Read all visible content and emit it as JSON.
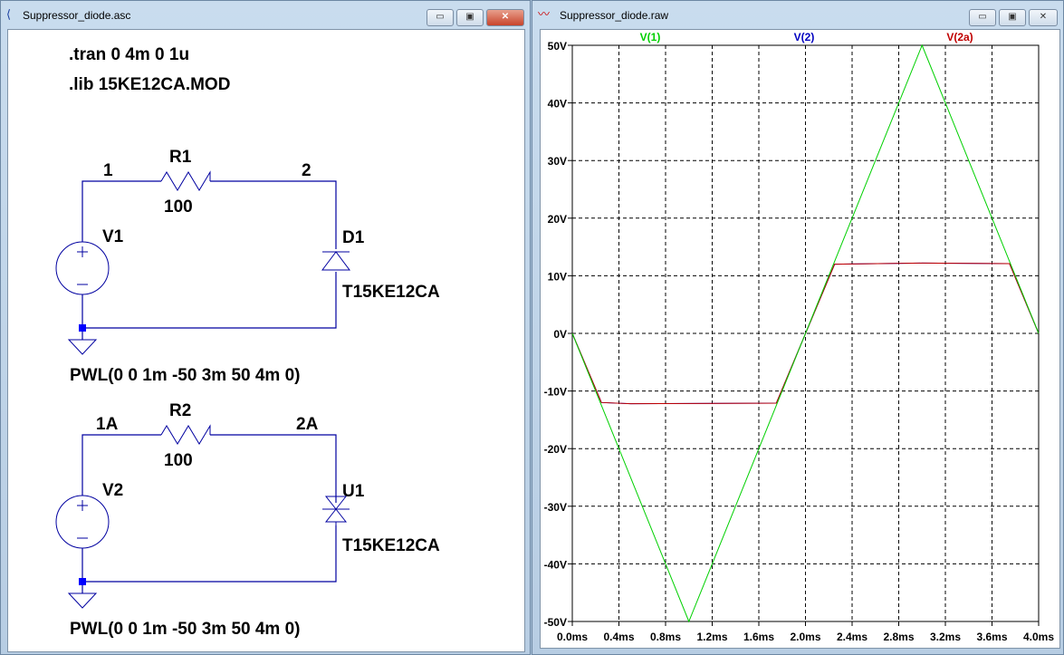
{
  "schematic_window": {
    "title": "Suppressor_diode.asc",
    "directives": [
      ".tran 0 4m 0 1u",
      ".lib 15KE12CA.MOD"
    ],
    "circuit1": {
      "node_in": "1",
      "node_out": "2",
      "resistor_name": "R1",
      "resistor_value": "100",
      "source_name": "V1",
      "diode_name": "D1",
      "diode_model": "T15KE12CA",
      "source_value": "PWL(0 0 1m -50 3m 50 4m  0)"
    },
    "circuit2": {
      "node_in": "1A",
      "node_out": "2A",
      "resistor_name": "R2",
      "resistor_value": "100",
      "source_name": "V2",
      "diode_name": "U1",
      "diode_model": "T15KE12CA",
      "source_value": "PWL(0 0 1m -50 3m 50 4m  0)"
    }
  },
  "waveform_window": {
    "title": "Suppressor_diode.raw"
  },
  "colors": {
    "wire": "#0000a0",
    "v1": "#00d000",
    "v2": "#0000c0",
    "v2a": "#c00000"
  },
  "chart_data": {
    "type": "line",
    "xlim": [
      0,
      4
    ],
    "ylim": [
      -50,
      50
    ],
    "x_ticks": [
      "0.0ms",
      "0.4ms",
      "0.8ms",
      "1.2ms",
      "1.6ms",
      "2.0ms",
      "2.4ms",
      "2.8ms",
      "3.2ms",
      "3.6ms",
      "4.0ms"
    ],
    "y_ticks": [
      "50V",
      "40V",
      "30V",
      "20V",
      "10V",
      "0V",
      "-10V",
      "-20V",
      "-30V",
      "-40V",
      "-50V"
    ],
    "grid": true,
    "legend_placement": "top",
    "series": [
      {
        "name": "V(1)",
        "color": "#00d000",
        "x": [
          0,
          1,
          3,
          4
        ],
        "y": [
          0,
          -50,
          50,
          0
        ]
      },
      {
        "name": "V(2)",
        "color": "#0000c0",
        "x": [
          0,
          0.25,
          0.5,
          1.75,
          2.25,
          3,
          3.75,
          4
        ],
        "y": [
          0,
          -12,
          -12.2,
          -12.1,
          12,
          12.2,
          12.1,
          0
        ]
      },
      {
        "name": "V(2a)",
        "color": "#c00000",
        "x": [
          0,
          0.25,
          0.5,
          1.75,
          2.25,
          3,
          3.75,
          4
        ],
        "y": [
          0,
          -12,
          -12.2,
          -12.1,
          12,
          12.2,
          12.1,
          0
        ]
      }
    ]
  }
}
